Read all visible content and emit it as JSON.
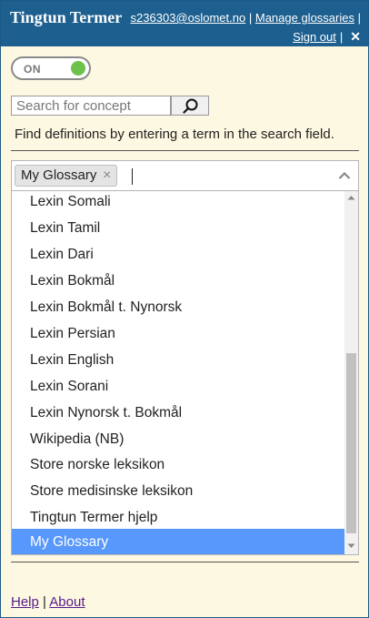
{
  "header": {
    "title": "Tingtun Termer",
    "user_email": "s236303@oslomet.no",
    "separator": "|",
    "manage_link": "Manage glossaries",
    "sign_out_link": "Sign out",
    "close_icon": "close-icon"
  },
  "toggle": {
    "label": "ON",
    "state": "on",
    "accent": "#6cc24a"
  },
  "search": {
    "placeholder": "Search for concept",
    "value": "",
    "button_icon": "search-icon"
  },
  "hint": "Find definitions by entering a term in the search field.",
  "glossary_select": {
    "selected_tag": "My Glossary",
    "remove_icon": "close-icon",
    "toggle_icon": "chevron-up-icon",
    "options": [
      "Lexin Somali",
      "Lexin Tamil",
      "Lexin Dari",
      "Lexin Bokmål",
      "Lexin Bokmål t. Nynorsk",
      "Lexin Persian",
      "Lexin English",
      "Lexin Sorani",
      "Lexin Nynorsk t. Bokmål",
      "Wikipedia (NB)",
      "Store norske leksikon",
      "Store medisinske leksikon",
      "Tingtun Termer hjelp",
      "My Glossary"
    ],
    "highlighted": "My Glossary",
    "highlight_color": "#5897fb"
  },
  "footer": {
    "help_link": "Help",
    "separator": "|",
    "about_link": "About"
  },
  "colors": {
    "header_bg": "#1d5f8f",
    "panel_bg": "#fdf8e2"
  }
}
